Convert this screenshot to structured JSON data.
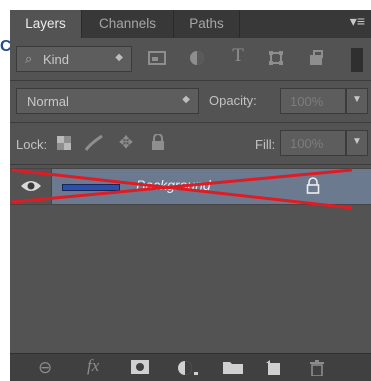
{
  "outside": {
    "fragment_text": "C"
  },
  "tabs": [
    {
      "label": "Layers",
      "active": true
    },
    {
      "label": "Channels",
      "active": false
    },
    {
      "label": "Paths",
      "active": false
    }
  ],
  "menu_icon": "▾≡",
  "filter": {
    "kind_label": "Kind",
    "icons": [
      "image-filter-icon",
      "adjustment-filter-icon",
      "type-filter-icon",
      "shape-filter-icon",
      "smart-object-filter-icon"
    ]
  },
  "blend": {
    "mode": "Normal",
    "opacity_label": "Opacity:",
    "opacity_value": "100%"
  },
  "lock": {
    "label": "Lock:",
    "fill_label": "Fill:",
    "fill_value": "100%"
  },
  "layers": [
    {
      "name": "Background",
      "visible": true,
      "locked": true
    }
  ],
  "colors": {
    "panel_bg": "#535353",
    "selected_layer": "#6b7a8f",
    "cross_out": "#e01b24",
    "thumb_line": "#2d4fa8"
  }
}
